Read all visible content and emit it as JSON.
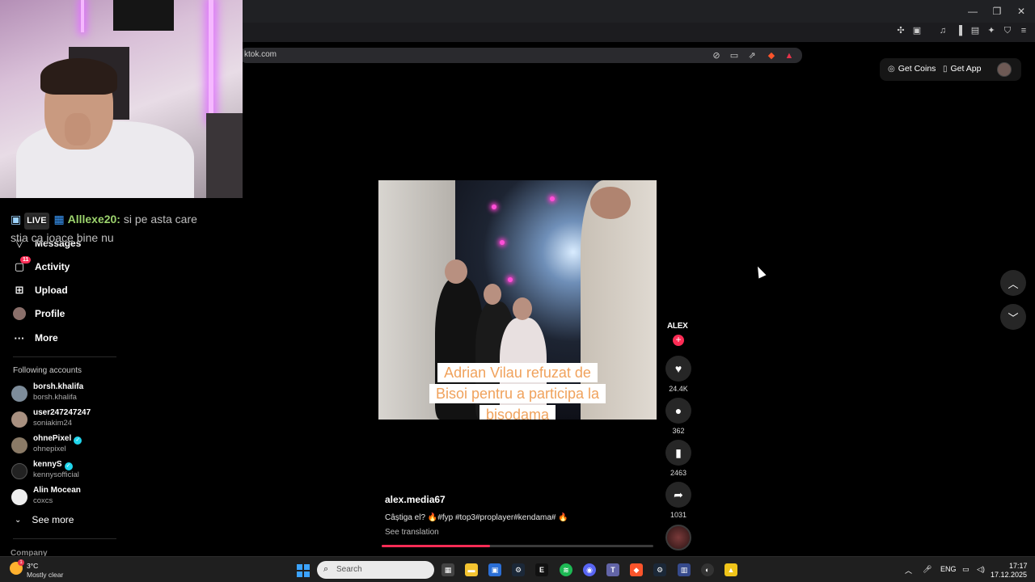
{
  "browser": {
    "url": "ktok.com",
    "window_controls": [
      "minimize",
      "restore",
      "close"
    ]
  },
  "chat_overlay": {
    "live_label": "LIVE",
    "username": "Alllexe20:",
    "message_line1": "si pe asta care",
    "message_line2": "stia ca joace bine nu"
  },
  "sidebar": {
    "nav": [
      {
        "label": "Messages",
        "icon": "paper-plane-icon"
      },
      {
        "label": "Activity",
        "icon": "message-icon",
        "badge": "11"
      },
      {
        "label": "Upload",
        "icon": "plus-square-icon"
      },
      {
        "label": "Profile",
        "icon": "profile-avatar"
      },
      {
        "label": "More",
        "icon": "ellipsis-icon"
      }
    ],
    "following_title": "Following accounts",
    "accounts": [
      {
        "name": "borsh.khalifa",
        "handle": "borsh.khalifa",
        "verified": false
      },
      {
        "name": "user247247247",
        "handle": "soniakim24",
        "verified": false
      },
      {
        "name": "ohnePixel",
        "handle": "ohnepixel",
        "verified": true
      },
      {
        "name": "kennyS",
        "handle": "kennysofficial",
        "verified": true
      },
      {
        "name": "Alin Mocean",
        "handle": "coxcs",
        "verified": false
      }
    ],
    "see_more": "See more",
    "company": "Company"
  },
  "top_actions": {
    "get_coins": "Get Coins",
    "get_app": "Get App"
  },
  "video": {
    "caption_line1": "Adrian Vilau refuzat de",
    "caption_line2": "Bisoi pentru a participa la",
    "caption_line3": "bisodama",
    "author": "alex.media67",
    "description": "Câștiga el? 🔥#fyp #top3#proplayer#kendama# 🔥",
    "see_translation": "See translation",
    "progress": 0.4
  },
  "rail": {
    "logo": "ALEX",
    "likes": "24.4K",
    "comments": "362",
    "saves": "2463",
    "shares": "1031"
  },
  "taskbar": {
    "weather_temp": "3°C",
    "weather_desc": "Mostly clear",
    "weather_badge": "1",
    "search_placeholder": "Search",
    "language": "ENG",
    "time": "17:17",
    "date": "17.12.2025"
  },
  "colors": {
    "accent": "#fe2c55",
    "caption_text": "#f0a25c"
  }
}
